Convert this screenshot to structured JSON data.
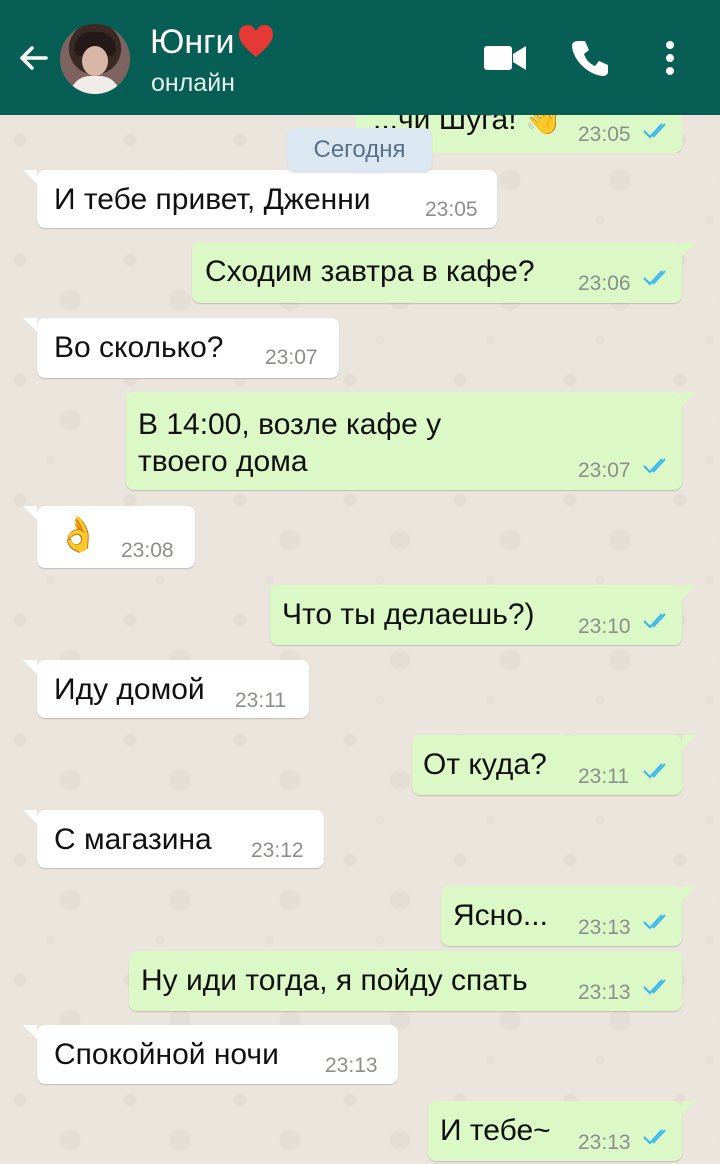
{
  "header": {
    "contact_name": "Юнги",
    "status": "онлайн",
    "colors": {
      "bar": "#075e54",
      "outgoing": "#dcf8c6",
      "read_ticks": "#34b7f1"
    }
  },
  "date_divider": "Сегодня",
  "messages": [
    {
      "side": "out",
      "text": "...чи Шуга! 👋",
      "time": "23:05"
    },
    {
      "side": "in",
      "text": "И тебе привет, Дженни",
      "time": "23:05"
    },
    {
      "side": "out",
      "text": "Сходим завтра в кафе?",
      "time": "23:06"
    },
    {
      "side": "in",
      "text": "Во сколько?",
      "time": "23:07"
    },
    {
      "side": "out",
      "text": "В 14:00, возле кафе у",
      "text2": "твоего дома",
      "time": "23:07"
    },
    {
      "side": "in",
      "text": "👌",
      "time": "23:08"
    },
    {
      "side": "out",
      "text": "Что ты делаешь?)",
      "time": "23:10"
    },
    {
      "side": "in",
      "text": "Иду домой",
      "time": "23:11"
    },
    {
      "side": "out",
      "text": "От куда?",
      "time": "23:11"
    },
    {
      "side": "in",
      "text": "С магазина",
      "time": "23:12"
    },
    {
      "side": "out",
      "text": "Ясно...",
      "time": "23:13"
    },
    {
      "side": "out",
      "text": "Ну иди тогда, я пойду спать",
      "time": "23:13"
    },
    {
      "side": "in",
      "text": "Спокойной ночи",
      "time": "23:13"
    },
    {
      "side": "out",
      "text": "И тебе~",
      "time": "23:13"
    }
  ]
}
